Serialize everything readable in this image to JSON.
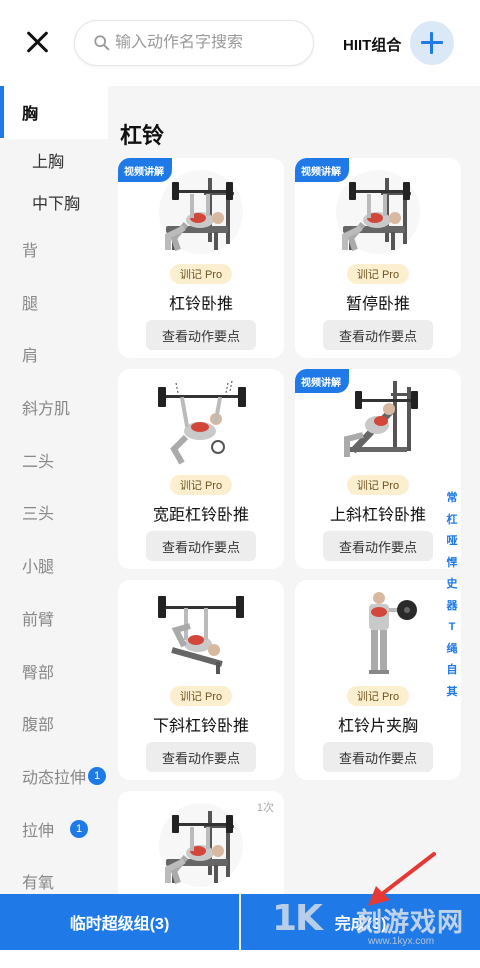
{
  "header": {
    "close_icon": "close-icon",
    "search_placeholder": "输入动作名字搜索",
    "search_icon": "search-icon",
    "hiit_label": "HIIT组合",
    "add_icon": "plus-icon"
  },
  "sidebar": {
    "active_category": "胸",
    "subcategories": [
      "上胸",
      "中下胸"
    ],
    "categories": [
      "背",
      "腿",
      "肩",
      "斜方肌",
      "二头",
      "三头",
      "小腿",
      "前臂",
      "臀部",
      "腹部",
      "动态拉伸",
      "拉伸",
      "有氧"
    ],
    "badges": {
      "dynamic_stretch": "1",
      "stretch": "1"
    }
  },
  "main": {
    "section_title": "杠铃",
    "video_tag": "视频讲解",
    "pro_tag": "训记 Pro",
    "keypoints_label": "查看动作要点",
    "exercises": [
      {
        "name": "杠铃卧推",
        "video": true,
        "pro": true
      },
      {
        "name": "暂停卧推",
        "video": true,
        "pro": true
      },
      {
        "name": "宽距杠铃卧推",
        "video": false,
        "pro": true
      },
      {
        "name": "上斜杠铃卧推",
        "video": true,
        "pro": true
      },
      {
        "name": "下斜杠铃卧推",
        "video": false,
        "pro": true
      },
      {
        "name": "杠铃片夹胸",
        "video": false,
        "pro": true
      },
      {
        "name": "",
        "count": "1次"
      }
    ],
    "index_letters": [
      "常",
      "杠",
      "哑",
      "悍",
      "史",
      "器",
      "T",
      "绳",
      "自",
      "其"
    ]
  },
  "bottom_bar": {
    "superset_label": "临时超级组(3)",
    "done_label": "完成(3)"
  },
  "watermark": {
    "logo": "1K",
    "text": "刻游戏网",
    "url": "www.1kyx.com"
  },
  "colors": {
    "accent": "#1f7ae8",
    "sidebar_bg": "#f5f5f5",
    "pro_bg": "#fbefcf",
    "arrow": "#e53935"
  }
}
